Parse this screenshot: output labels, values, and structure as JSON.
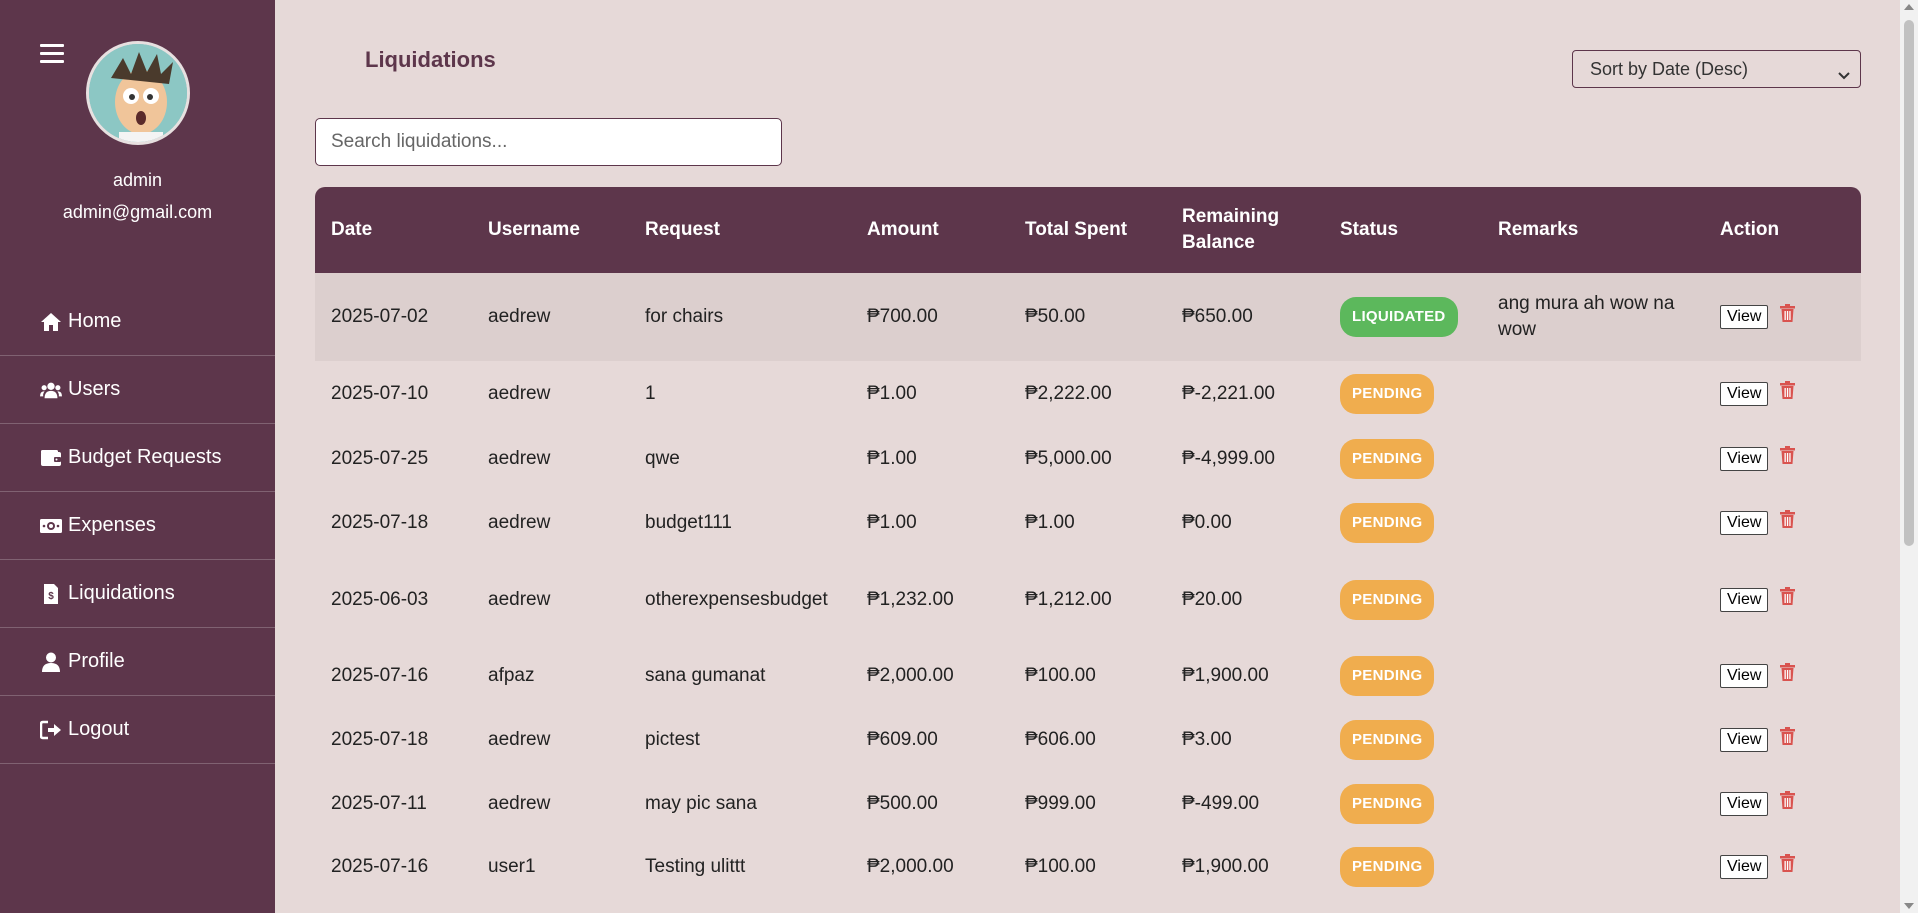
{
  "sidebar": {
    "user": {
      "name": "admin",
      "email": "admin@gmail.com"
    },
    "items": [
      {
        "label": "Home",
        "icon": "home-icon"
      },
      {
        "label": "Users",
        "icon": "users-icon"
      },
      {
        "label": "Budget Requests",
        "icon": "wallet-icon"
      },
      {
        "label": "Expenses",
        "icon": "money-bill-icon"
      },
      {
        "label": "Liquidations",
        "icon": "file-invoice-icon"
      },
      {
        "label": "Profile",
        "icon": "user-icon"
      },
      {
        "label": "Logout",
        "icon": "logout-icon"
      }
    ]
  },
  "main": {
    "title": "Liquidations",
    "sort": {
      "selected": "Sort by Date (Desc)"
    },
    "search": {
      "placeholder": "Search liquidations..."
    },
    "table": {
      "columns": [
        "Date",
        "Username",
        "Request",
        "Amount",
        "Total Spent",
        "Remaining Balance",
        "Status",
        "Remarks",
        "Action"
      ],
      "view_label": "View",
      "rows": [
        {
          "date": "2025-07-02",
          "username": "aedrew",
          "request": "for chairs",
          "amount": "₱700.00",
          "spent": "₱50.00",
          "balance": "₱650.00",
          "status": "LIQUIDATED",
          "remarks": "ang mura ah wow na wow"
        },
        {
          "date": "2025-07-10",
          "username": "aedrew",
          "request": "1",
          "amount": "₱1.00",
          "spent": "₱2,222.00",
          "balance": "₱-2,221.00",
          "status": "PENDING",
          "remarks": ""
        },
        {
          "date": "2025-07-25",
          "username": "aedrew",
          "request": "qwe",
          "amount": "₱1.00",
          "spent": "₱5,000.00",
          "balance": "₱-4,999.00",
          "status": "PENDING",
          "remarks": ""
        },
        {
          "date": "2025-07-18",
          "username": "aedrew",
          "request": "budget111",
          "amount": "₱1.00",
          "spent": "₱1.00",
          "balance": "₱0.00",
          "status": "PENDING",
          "remarks": ""
        },
        {
          "date": "2025-06-03",
          "username": "aedrew",
          "request": "otherexpensesbudget",
          "amount": "₱1,232.00",
          "spent": "₱1,212.00",
          "balance": "₱20.00",
          "status": "PENDING",
          "remarks": ""
        },
        {
          "date": "2025-07-16",
          "username": "afpaz",
          "request": "sana gumanat",
          "amount": "₱2,000.00",
          "spent": "₱100.00",
          "balance": "₱1,900.00",
          "status": "PENDING",
          "remarks": ""
        },
        {
          "date": "2025-07-18",
          "username": "aedrew",
          "request": "pictest",
          "amount": "₱609.00",
          "spent": "₱606.00",
          "balance": "₱3.00",
          "status": "PENDING",
          "remarks": ""
        },
        {
          "date": "2025-07-11",
          "username": "aedrew",
          "request": "may pic sana",
          "amount": "₱500.00",
          "spent": "₱999.00",
          "balance": "₱-499.00",
          "status": "PENDING",
          "remarks": ""
        },
        {
          "date": "2025-07-16",
          "username": "user1",
          "request": "Testing ulittt",
          "amount": "₱2,000.00",
          "spent": "₱100.00",
          "balance": "₱1,900.00",
          "status": "PENDING",
          "remarks": ""
        }
      ]
    }
  },
  "colors": {
    "sidebar": "#5d364b",
    "background": "#e6d9d8",
    "liquidated": "#5cb85c",
    "pending": "#f0ad4e",
    "delete": "#d9534f"
  }
}
